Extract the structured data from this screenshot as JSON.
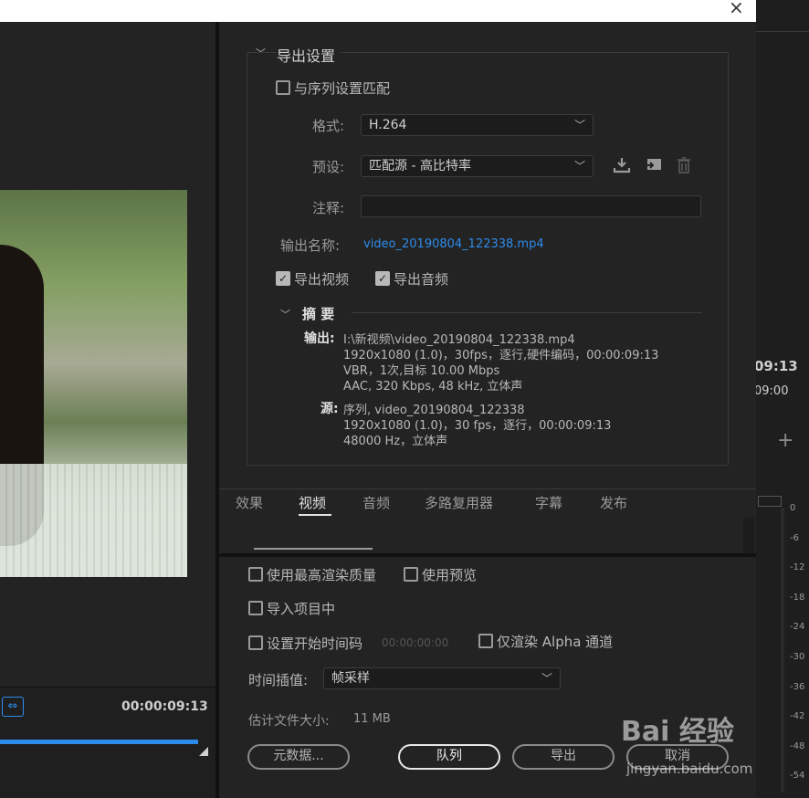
{
  "window": {
    "close_glyph": "×"
  },
  "export_settings": {
    "title": "导出设置",
    "match_sequence": "与序列设置匹配",
    "format_label": "格式:",
    "format_value": "H.264",
    "preset_label": "预设:",
    "preset_value": "匹配源 - 高比特率",
    "comment_label": "注释:",
    "comment_value": "",
    "output_name_label": "输出名称:",
    "output_name_value": "video_20190804_122338.mp4",
    "export_video": "导出视频",
    "export_audio": "导出音频",
    "export_video_checked": true,
    "export_audio_checked": true
  },
  "summary": {
    "title": "摘 要",
    "output_key": "输出:",
    "output_lines": [
      "I:\\新视频\\video_20190804_122338.mp4",
      "1920x1080 (1.0)，30fps，逐行,硬件编码，00:00:09:13",
      "VBR，1次,目标 10.00 Mbps",
      "AAC, 320 Kbps, 48  kHz, 立体声"
    ],
    "source_key": "源:",
    "source_lines": [
      "序列, video_20190804_122338",
      "1920x1080 (1.0)，30 fps，逐行，00:00:09:13",
      "48000 Hz，立体声"
    ]
  },
  "tabs": [
    {
      "label": "效果",
      "active": false
    },
    {
      "label": "视频",
      "active": true
    },
    {
      "label": "音频",
      "active": false
    },
    {
      "label": "多路复用器",
      "active": false
    },
    {
      "label": "字幕",
      "active": false
    },
    {
      "label": "发布",
      "active": false
    }
  ],
  "bottom": {
    "use_max_quality": "使用最高渲染质量",
    "use_preview": "使用预览",
    "import_into_project": "导入项目中",
    "set_start_timecode": "设置开始时间码",
    "start_timecode_value": "00:00:00:00",
    "render_alpha_only": "仅渲染 Alpha 通道",
    "time_interp_label": "时间插值:",
    "time_interp_value": "帧采样",
    "est_size_label": "估计文件大小:",
    "est_size_value": "11 MB",
    "metadata_btn": "元数据...",
    "queue_btn": "队列",
    "export_btn": "导出",
    "cancel_btn": "取消"
  },
  "left_panel": {
    "timecode": "00:00:09:13"
  },
  "right_panel": {
    "timecode_big": "09:13",
    "timecode_small": "09:00",
    "plus": "+",
    "meter_labels": [
      "0",
      "-6",
      "-12",
      "-18",
      "-24",
      "-30",
      "-36",
      "-42",
      "-48",
      "-54"
    ]
  },
  "watermark": {
    "brand": "Bai 经验",
    "url": "jingyan.baidu.com"
  },
  "colors": {
    "accent": "#2d8ceb",
    "panel": "#232323"
  }
}
